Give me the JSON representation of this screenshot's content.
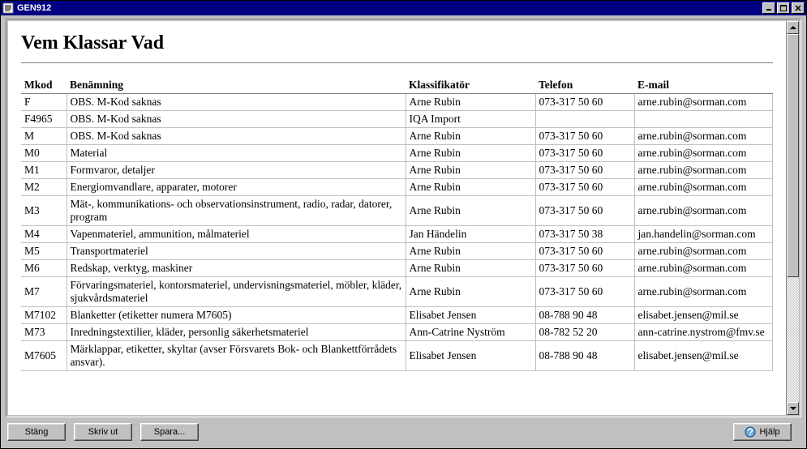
{
  "window": {
    "title": "GEN912"
  },
  "page": {
    "heading": "Vem Klassar Vad"
  },
  "table": {
    "headers": {
      "mkod": "Mkod",
      "benamning": "Benämning",
      "klassifikator": "Klassifikatör",
      "telefon": "Telefon",
      "email": "E-mail"
    },
    "rows": [
      {
        "mkod": "F",
        "benamning": "OBS. M-Kod saknas",
        "klassifikator": "Arne Rubin",
        "telefon": "073-317 50 60",
        "email": "arne.rubin@sorman.com"
      },
      {
        "mkod": "F4965",
        "benamning": "OBS. M-Kod saknas",
        "klassifikator": "IQA Import",
        "telefon": "",
        "email": ""
      },
      {
        "mkod": "M",
        "benamning": "OBS. M-Kod saknas",
        "klassifikator": "Arne Rubin",
        "telefon": "073-317 50 60",
        "email": "arne.rubin@sorman.com"
      },
      {
        "mkod": "M0",
        "benamning": "Material",
        "klassifikator": "Arne Rubin",
        "telefon": "073-317 50 60",
        "email": "arne.rubin@sorman.com"
      },
      {
        "mkod": "M1",
        "benamning": "Formvaror, detaljer",
        "klassifikator": "Arne Rubin",
        "telefon": "073-317 50 60",
        "email": "arne.rubin@sorman.com"
      },
      {
        "mkod": "M2",
        "benamning": "Energiomvandlare, apparater, motorer",
        "klassifikator": "Arne Rubin",
        "telefon": "073-317 50 60",
        "email": "arne.rubin@sorman.com"
      },
      {
        "mkod": "M3",
        "benamning": "Mät-, kommunikations- och observationsinstrument, radio, radar, datorer, program",
        "klassifikator": "Arne Rubin",
        "telefon": "073-317 50 60",
        "email": "arne.rubin@sorman.com"
      },
      {
        "mkod": "M4",
        "benamning": "Vapenmateriel, ammunition, målmateriel",
        "klassifikator": "Jan Händelin",
        "telefon": "073-317 50 38",
        "email": "jan.handelin@sorman.com"
      },
      {
        "mkod": "M5",
        "benamning": "Transportmateriel",
        "klassifikator": "Arne Rubin",
        "telefon": "073-317 50 60",
        "email": "arne.rubin@sorman.com"
      },
      {
        "mkod": "M6",
        "benamning": "Redskap, verktyg, maskiner",
        "klassifikator": "Arne Rubin",
        "telefon": "073-317 50 60",
        "email": "arne.rubin@sorman.com"
      },
      {
        "mkod": "M7",
        "benamning": "Förvaringsmateriel, kontorsmateriel, undervisningsmateriel, möbler, kläder, sjukvårdsmateriel",
        "klassifikator": "Arne Rubin",
        "telefon": "073-317 50 60",
        "email": "arne.rubin@sorman.com"
      },
      {
        "mkod": "M7102",
        "benamning": "Blanketter (etiketter numera M7605)",
        "klassifikator": "Elisabet Jensen",
        "telefon": "08-788 90 48",
        "email": "elisabet.jensen@mil.se"
      },
      {
        "mkod": "M73",
        "benamning": "Inredningstextilier, kläder, personlig säkerhetsmateriel",
        "klassifikator": "Ann-Catrine Nyström",
        "telefon": "08-782 52 20",
        "email": "ann-catrine.nystrom@fmv.se"
      },
      {
        "mkod": "M7605",
        "benamning": "Märklappar, etiketter, skyltar (avser Försvarets Bok- och Blankettförrådets ansvar).",
        "klassifikator": "Elisabet Jensen",
        "telefon": "08-788 90 48",
        "email": "elisabet.jensen@mil.se"
      }
    ]
  },
  "buttons": {
    "close": "Stäng",
    "print": "Skriv ut",
    "save": "Spara...",
    "help": "Hjälp"
  }
}
